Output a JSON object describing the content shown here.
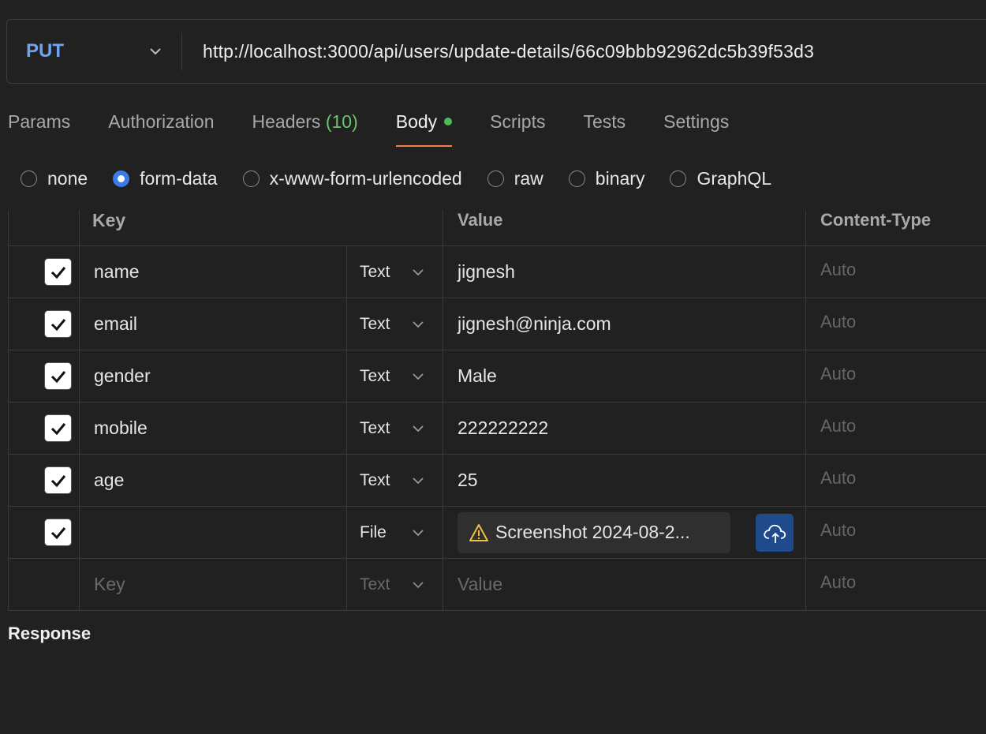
{
  "request": {
    "method": "PUT",
    "url": "http://localhost:3000/api/users/update-details/66c09bbb92962dc5b39f53d3"
  },
  "tabs": [
    {
      "label": "Params"
    },
    {
      "label": "Authorization"
    },
    {
      "label": "Headers",
      "count": "(10)"
    },
    {
      "label": "Body",
      "active": true
    },
    {
      "label": "Scripts"
    },
    {
      "label": "Tests"
    },
    {
      "label": "Settings"
    }
  ],
  "body_types": [
    {
      "label": "none"
    },
    {
      "label": "form-data",
      "selected": true
    },
    {
      "label": "x-www-form-urlencoded"
    },
    {
      "label": "raw"
    },
    {
      "label": "binary"
    },
    {
      "label": "GraphQL"
    }
  ],
  "table": {
    "headers": {
      "key": "Key",
      "value": "Value",
      "content_type": "Content-Type"
    },
    "rows": [
      {
        "key": "name",
        "type": "Text",
        "value": "jignesh",
        "content_type": "Auto"
      },
      {
        "key": "email",
        "type": "Text",
        "value": "jignesh@ninja.com",
        "content_type": "Auto"
      },
      {
        "key": "gender",
        "type": "Text",
        "value": "Male",
        "content_type": "Auto"
      },
      {
        "key": "mobile",
        "type": "Text",
        "value": "222222222",
        "content_type": "Auto"
      },
      {
        "key": "age",
        "type": "Text",
        "value": "25",
        "content_type": "Auto"
      },
      {
        "key": "",
        "type": "File",
        "value": "Screenshot 2024-08-2...",
        "content_type": "Auto"
      }
    ],
    "new_row": {
      "key_placeholder": "Key",
      "type": "Text",
      "value_placeholder": "Value",
      "content_type": "Auto"
    }
  },
  "response_label": "Response",
  "colors": {
    "background": "#212121",
    "method": "#6fa4f0",
    "active_tab_underline": "#f08050",
    "body_dot": "#4cbb5a",
    "radio_selected": "#3b7be8",
    "upload_button": "#1f4a8c"
  }
}
